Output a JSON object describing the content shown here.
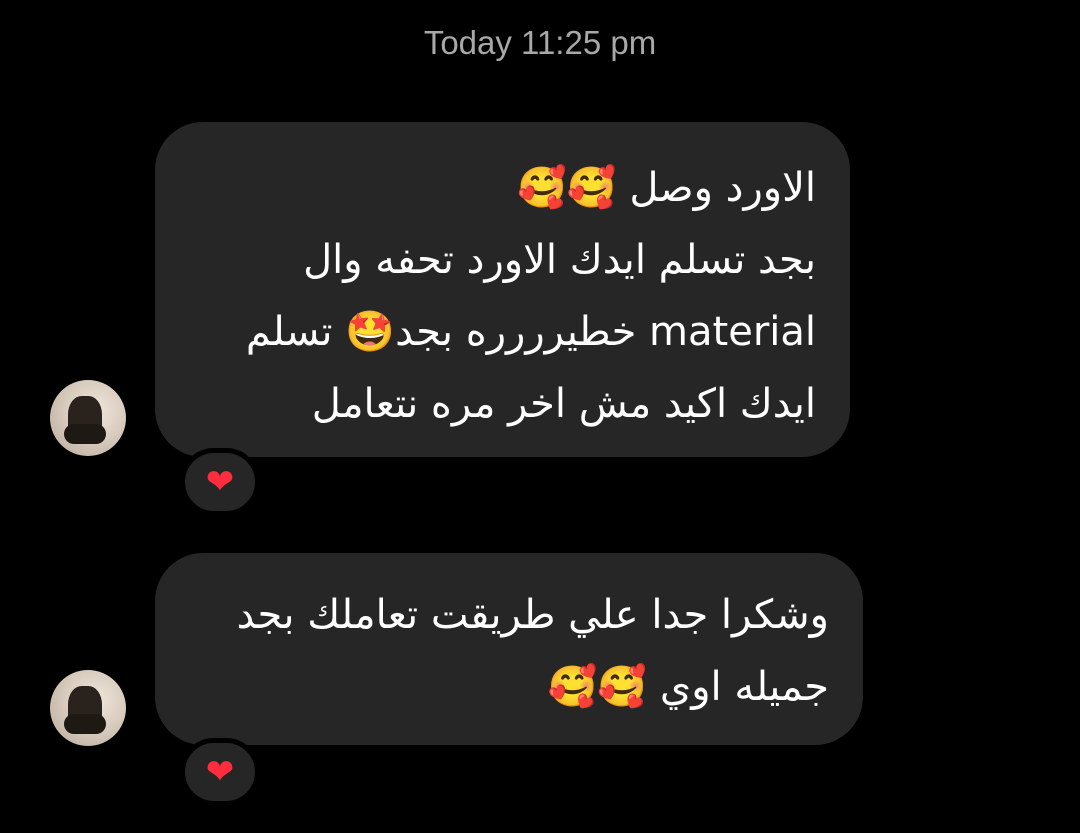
{
  "chat": {
    "timestamp": "Today 11:25 pm",
    "messages": [
      {
        "lines": [
          "الاورد وصل 🥰🥰",
          "بجد تسلم ايدك الاورد تحفه وال",
          "material خطيرررره بجد🤩 تسلم",
          "ايدك اكيد مش اخر مره نتعامل"
        ],
        "reaction": "❤"
      },
      {
        "lines": [
          "وشكرا جدا علي طريقت تعاملك بجد",
          "جميله اوي 🥰🥰"
        ],
        "reaction": "❤"
      }
    ]
  }
}
